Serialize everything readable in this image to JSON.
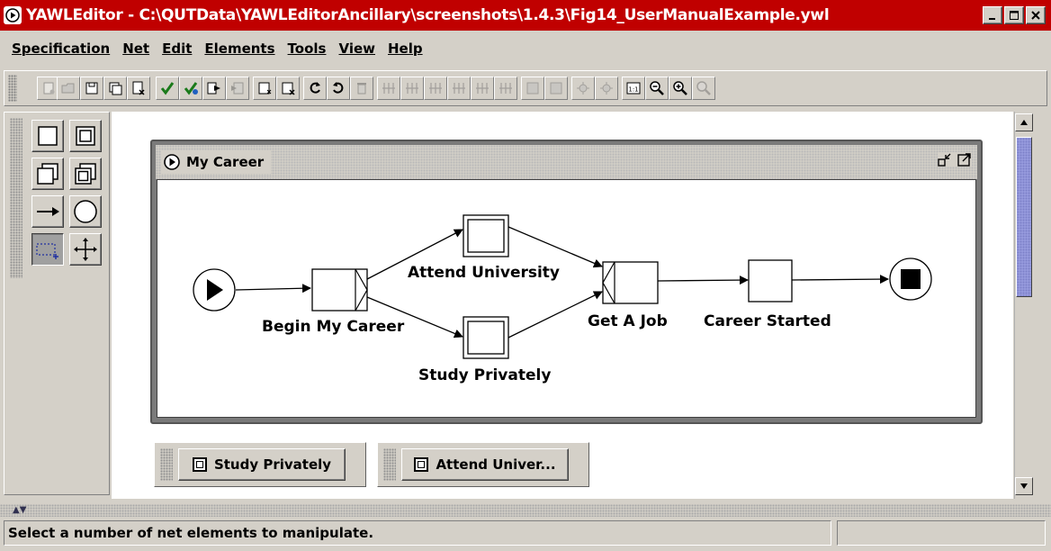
{
  "window": {
    "title": "YAWLEditor - C:\\QUTData\\YAWLEditorAncillary\\screenshots\\1.4.3\\Fig14_UserManualExample.ywl",
    "title_bar_color": "#c00000"
  },
  "menu": [
    "Specification",
    "Net",
    "Edit",
    "Elements",
    "Tools",
    "View",
    "Help"
  ],
  "toolbar": {
    "icons": [
      {
        "name": "new-specification-icon",
        "enabled": false
      },
      {
        "name": "open-specification-icon",
        "enabled": false
      },
      {
        "name": "save-specification-icon",
        "enabled": true
      },
      {
        "name": "save-as-icon",
        "enabled": true
      },
      {
        "name": "close-specification-icon",
        "enabled": true
      },
      {
        "name": "validate-icon",
        "enabled": true
      },
      {
        "name": "analyse-icon",
        "enabled": true
      },
      {
        "name": "export-engine-icon",
        "enabled": true
      },
      {
        "name": "import-engine-icon",
        "enabled": false
      },
      {
        "name": "create-net-icon",
        "enabled": true
      },
      {
        "name": "remove-net-icon",
        "enabled": true
      },
      {
        "name": "undo-icon",
        "enabled": true
      },
      {
        "name": "redo-icon",
        "enabled": true
      },
      {
        "name": "delete-icon",
        "enabled": false
      },
      {
        "name": "align-top-icon",
        "enabled": false
      },
      {
        "name": "align-middle-icon",
        "enabled": false
      },
      {
        "name": "align-bottom-icon",
        "enabled": false
      },
      {
        "name": "align-left-icon",
        "enabled": false
      },
      {
        "name": "align-center-icon",
        "enabled": false
      },
      {
        "name": "align-right-icon",
        "enabled": false
      },
      {
        "name": "increase-size-icon",
        "enabled": false
      },
      {
        "name": "decrease-size-icon",
        "enabled": false
      },
      {
        "name": "add-to-visible-icon",
        "enabled": false
      },
      {
        "name": "remove-from-visible-icon",
        "enabled": false
      },
      {
        "name": "zoom-actual-icon",
        "enabled": true
      },
      {
        "name": "zoom-out-icon",
        "enabled": true
      },
      {
        "name": "zoom-in-icon",
        "enabled": true
      },
      {
        "name": "zoom-selected-icon",
        "enabled": false
      }
    ]
  },
  "palette": [
    {
      "name": "atomic-task-tool-icon",
      "selected": false
    },
    {
      "name": "composite-task-tool-icon",
      "selected": false
    },
    {
      "name": "multiple-atomic-task-tool-icon",
      "selected": false
    },
    {
      "name": "multiple-composite-task-tool-icon",
      "selected": false
    },
    {
      "name": "flow-relation-tool-icon",
      "selected": false
    },
    {
      "name": "condition-tool-icon",
      "selected": false
    },
    {
      "name": "marquee-select-tool-icon",
      "selected": true
    },
    {
      "name": "drag-net-tool-icon",
      "selected": false
    }
  ],
  "net": {
    "title": "My Career",
    "labels": {
      "begin": "Begin My Career",
      "attend": "Attend University",
      "study": "Study Privately",
      "job": "Get A Job",
      "started": "Career Started"
    }
  },
  "minimized": [
    {
      "label": "Study Privately"
    },
    {
      "label": "Attend Univer..."
    }
  ],
  "status": {
    "message": "Select a number of net elements to manipulate."
  }
}
